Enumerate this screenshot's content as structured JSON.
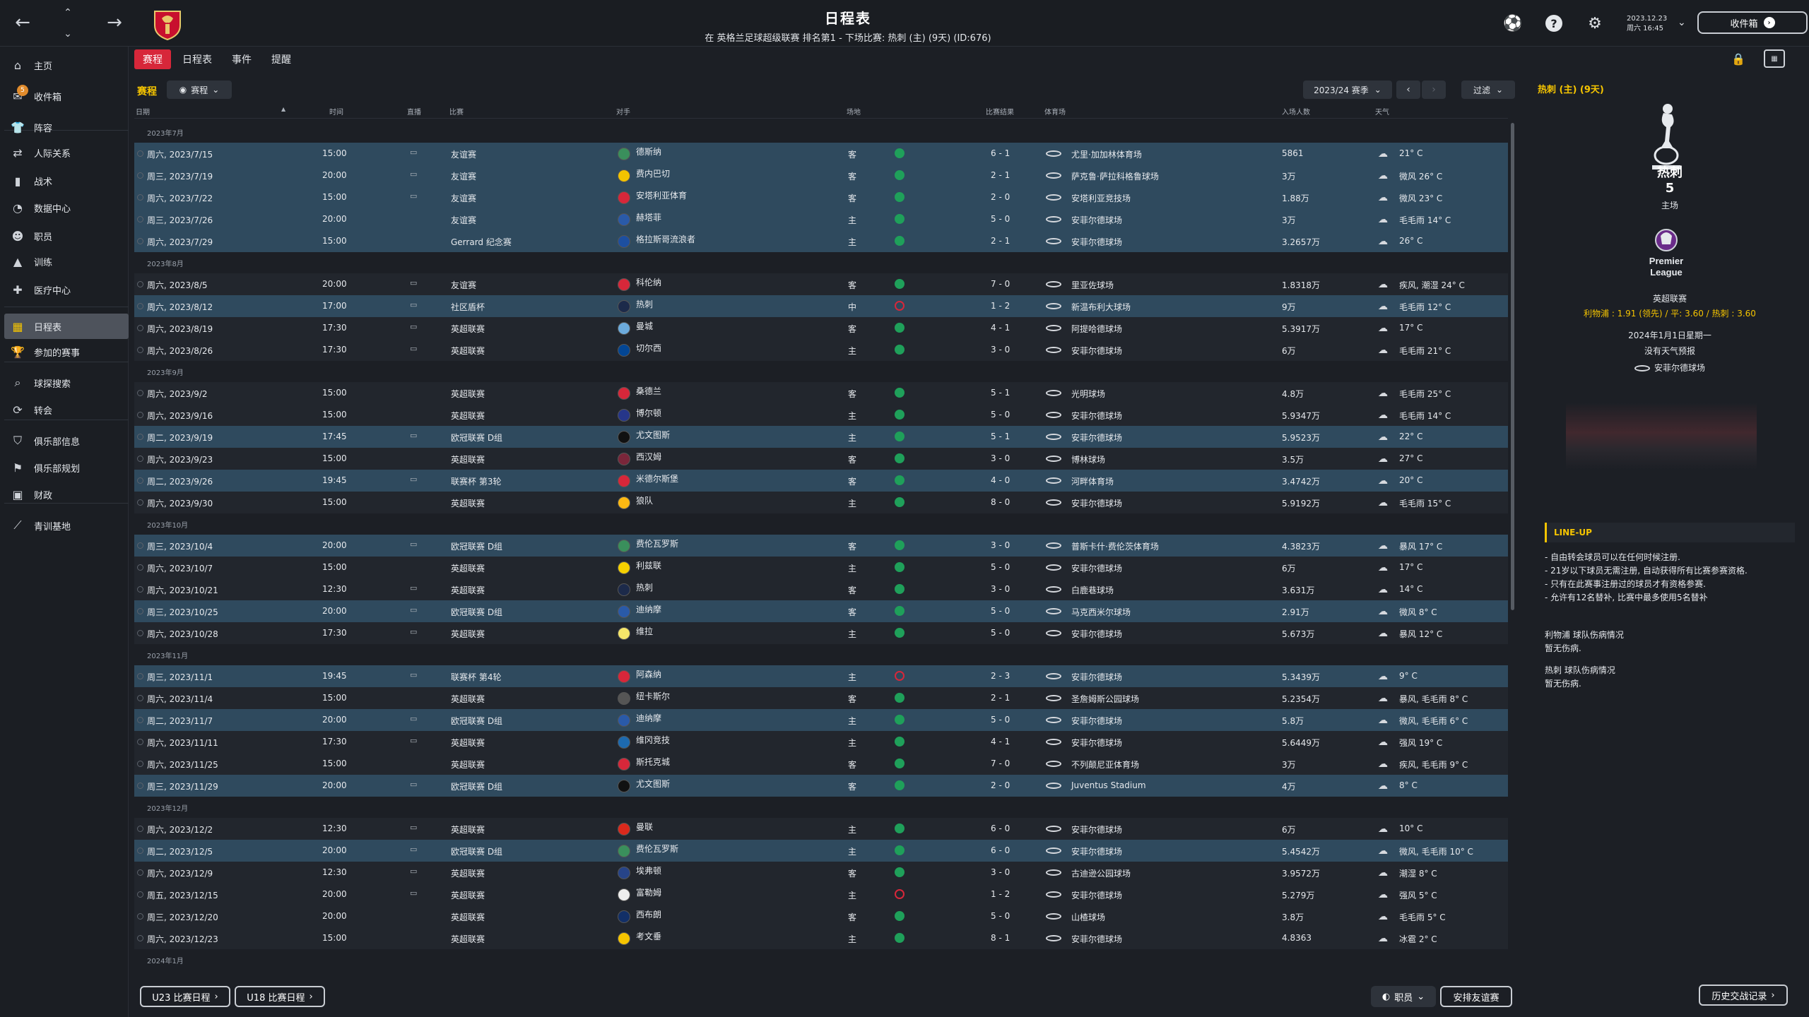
{
  "header": {
    "title": "日程表",
    "subtitle": "在 英格兰足球超级联赛 排名第1 - 下场比赛: 热刺 (主) (9天) (ID:676)",
    "date_line1": "2023.12.23",
    "date_line2": "周六 16:45",
    "inbox_label": "收件箱"
  },
  "sidebar": {
    "items": [
      {
        "label": "主页",
        "icon": "home-icon"
      },
      {
        "label": "收件箱",
        "icon": "inbox-icon",
        "badge": "5"
      },
      {
        "label": "阵容",
        "icon": "shirt-icon"
      },
      {
        "label": "人际关系",
        "icon": "relations-icon"
      },
      {
        "label": "战术",
        "icon": "tactics-icon"
      },
      {
        "label": "数据中心",
        "icon": "data-icon"
      },
      {
        "label": "职员",
        "icon": "staff-icon"
      },
      {
        "label": "训练",
        "icon": "training-icon"
      },
      {
        "label": "医疗中心",
        "icon": "medical-icon"
      },
      {
        "label": "日程表",
        "icon": "calendar-icon"
      },
      {
        "label": "参加的赛事",
        "icon": "trophy-icon"
      },
      {
        "label": "球探搜索",
        "icon": "search-icon"
      },
      {
        "label": "转会",
        "icon": "transfer-icon"
      },
      {
        "label": "俱乐部信息",
        "icon": "shield-icon"
      },
      {
        "label": "俱乐部规划",
        "icon": "vision-icon"
      },
      {
        "label": "财政",
        "icon": "finance-icon"
      },
      {
        "label": "青训基地",
        "icon": "youth-icon"
      }
    ]
  },
  "tabs": [
    "赛程",
    "日程表",
    "事件",
    "提醒"
  ],
  "subheader": {
    "title": "赛程",
    "dropdown": "赛程",
    "season": "2023/24 赛季",
    "filter": "过滤"
  },
  "columns": [
    "日期",
    "时间",
    "直播",
    "比赛",
    "对手",
    "场地",
    "比赛结果",
    "体育场",
    "入场人数",
    "天气"
  ],
  "groups": [
    {
      "month": "2023年7月",
      "rows": [
        {
          "date": "周六, 2023/7/15",
          "time": "15:00",
          "tv": true,
          "comp": "友谊赛",
          "opp": "德斯纳",
          "venue": "客",
          "res": "w",
          "score": "6 - 1",
          "stadium": "尤里·加加林体育场",
          "att": "5861",
          "weather": "21° C",
          "hl": true,
          "crest": "#3a8f5c"
        },
        {
          "date": "周三, 2023/7/19",
          "time": "20:00",
          "tv": true,
          "comp": "友谊赛",
          "opp": "费内巴切",
          "venue": "客",
          "res": "w",
          "score": "2 - 1",
          "stadium": "萨克鲁·萨拉科格鲁球场",
          "att": "3万",
          "weather": "微风 26° C",
          "hl": true,
          "crest": "#f2c300"
        },
        {
          "date": "周六, 2023/7/22",
          "time": "15:00",
          "tv": true,
          "comp": "友谊赛",
          "opp": "安塔利亚体育",
          "venue": "客",
          "res": "w",
          "score": "2 - 0",
          "stadium": "安塔利亚竞技场",
          "att": "1.88万",
          "weather": "微风 23° C",
          "hl": true,
          "crest": "#d7273a"
        },
        {
          "date": "周三, 2023/7/26",
          "time": "20:00",
          "tv": false,
          "comp": "友谊赛",
          "opp": "赫塔菲",
          "venue": "主",
          "res": "w",
          "score": "5 - 0",
          "stadium": "安菲尔德球场",
          "att": "3万",
          "weather": "毛毛雨 14° C",
          "hl": true,
          "crest": "#2a5aa8"
        },
        {
          "date": "周六, 2023/7/29",
          "time": "15:00",
          "tv": false,
          "comp": "Gerrard 纪念赛",
          "opp": "格拉斯哥流浪者",
          "venue": "主",
          "res": "w",
          "score": "2 - 1",
          "stadium": "安菲尔德球场",
          "att": "3.2657万",
          "weather": "26° C",
          "hl": true,
          "crest": "#1d4fa0"
        }
      ]
    },
    {
      "month": "2023年8月",
      "rows": [
        {
          "date": "周六, 2023/8/5",
          "time": "20:00",
          "tv": true,
          "comp": "友谊赛",
          "opp": "科伦纳",
          "venue": "客",
          "res": "w",
          "score": "7 - 0",
          "stadium": "里亚佐球场",
          "att": "1.8318万",
          "weather": "疾风, 潮湿 24° C",
          "hl": false,
          "crest": "#d7273a"
        },
        {
          "date": "周六, 2023/8/12",
          "time": "17:00",
          "tv": true,
          "comp": "社区盾杯",
          "opp": "热刺",
          "venue": "中",
          "res": "l",
          "score": "1 - 2",
          "stadium": "新温布利大球场",
          "att": "9万",
          "weather": "毛毛雨 12° C",
          "hl": true,
          "crest": "#1c2a4a"
        },
        {
          "date": "周六, 2023/8/19",
          "time": "17:30",
          "tv": true,
          "comp": "英超联赛",
          "opp": "曼城",
          "venue": "客",
          "res": "w",
          "score": "4 - 1",
          "stadium": "阿提哈德球场",
          "att": "5.3917万",
          "weather": "17° C",
          "hl": false,
          "crest": "#6cabdd"
        },
        {
          "date": "周六, 2023/8/26",
          "time": "17:30",
          "tv": true,
          "comp": "英超联赛",
          "opp": "切尔西",
          "venue": "主",
          "res": "w",
          "score": "3 - 0",
          "stadium": "安菲尔德球场",
          "att": "6万",
          "weather": "毛毛雨 21° C",
          "hl": false,
          "crest": "#034694"
        }
      ]
    },
    {
      "month": "2023年9月",
      "rows": [
        {
          "date": "周六, 2023/9/2",
          "time": "15:00",
          "tv": false,
          "comp": "英超联赛",
          "opp": "桑德兰",
          "venue": "客",
          "res": "w",
          "score": "5 - 1",
          "stadium": "光明球场",
          "att": "4.8万",
          "weather": "毛毛雨 25° C",
          "hl": false,
          "crest": "#d7273a"
        },
        {
          "date": "周六, 2023/9/16",
          "time": "15:00",
          "tv": false,
          "comp": "英超联赛",
          "opp": "博尔顿",
          "venue": "主",
          "res": "w",
          "score": "5 - 0",
          "stadium": "安菲尔德球场",
          "att": "5.9347万",
          "weather": "毛毛雨 14° C",
          "hl": false,
          "crest": "#26368a"
        },
        {
          "date": "周二, 2023/9/19",
          "time": "17:45",
          "tv": true,
          "comp": "欧冠联赛 D组",
          "opp": "尤文图斯",
          "venue": "主",
          "res": "w",
          "score": "5 - 1",
          "stadium": "安菲尔德球场",
          "att": "5.9523万",
          "weather": "22° C",
          "hl": true,
          "crest": "#111111"
        },
        {
          "date": "周六, 2023/9/23",
          "time": "15:00",
          "tv": false,
          "comp": "英超联赛",
          "opp": "西汉姆",
          "venue": "客",
          "res": "w",
          "score": "3 - 0",
          "stadium": "博林球场",
          "att": "3.5万",
          "weather": "27° C",
          "hl": false,
          "crest": "#7a263a"
        },
        {
          "date": "周二, 2023/9/26",
          "time": "19:45",
          "tv": true,
          "comp": "联赛杯 第3轮",
          "opp": "米德尔斯堡",
          "venue": "客",
          "res": "w",
          "score": "4 - 0",
          "stadium": "河畔体育场",
          "att": "3.4742万",
          "weather": "20° C",
          "hl": true,
          "crest": "#d7273a"
        },
        {
          "date": "周六, 2023/9/30",
          "time": "15:00",
          "tv": false,
          "comp": "英超联赛",
          "opp": "狼队",
          "venue": "主",
          "res": "w",
          "score": "8 - 0",
          "stadium": "安菲尔德球场",
          "att": "5.9192万",
          "weather": "毛毛雨 15° C",
          "hl": false,
          "crest": "#fdb913"
        }
      ]
    },
    {
      "month": "2023年10月",
      "rows": [
        {
          "date": "周三, 2023/10/4",
          "time": "20:00",
          "tv": true,
          "comp": "欧冠联赛 D组",
          "opp": "费伦瓦罗斯",
          "venue": "客",
          "res": "w",
          "score": "3 - 0",
          "stadium": "普斯卡什·费伦茨体育场",
          "att": "4.3823万",
          "weather": "暴风 17° C",
          "hl": true,
          "crest": "#3a8f5c"
        },
        {
          "date": "周六, 2023/10/7",
          "time": "15:00",
          "tv": false,
          "comp": "英超联赛",
          "opp": "利兹联",
          "venue": "主",
          "res": "w",
          "score": "5 - 0",
          "stadium": "安菲尔德球场",
          "att": "6万",
          "weather": "17° C",
          "hl": false,
          "crest": "#f5d000"
        },
        {
          "date": "周六, 2023/10/21",
          "time": "12:30",
          "tv": true,
          "comp": "英超联赛",
          "opp": "热刺",
          "venue": "客",
          "res": "w",
          "score": "3 - 0",
          "stadium": "白鹿巷球场",
          "att": "3.631万",
          "weather": "14° C",
          "hl": false,
          "crest": "#1c2a4a"
        },
        {
          "date": "周三, 2023/10/25",
          "time": "20:00",
          "tv": true,
          "comp": "欧冠联赛 D组",
          "opp": "迪纳摩",
          "venue": "客",
          "res": "w",
          "score": "5 - 0",
          "stadium": "马克西米尔球场",
          "att": "2.91万",
          "weather": "微风 8° C",
          "hl": true,
          "crest": "#2a5aa8"
        },
        {
          "date": "周六, 2023/10/28",
          "time": "17:30",
          "tv": true,
          "comp": "英超联赛",
          "opp": "维拉",
          "venue": "主",
          "res": "w",
          "score": "5 - 0",
          "stadium": "安菲尔德球场",
          "att": "5.673万",
          "weather": "暴风 12° C",
          "hl": false,
          "crest": "#f5e66a"
        }
      ]
    },
    {
      "month": "2023年11月",
      "rows": [
        {
          "date": "周三, 2023/11/1",
          "time": "19:45",
          "tv": true,
          "comp": "联赛杯 第4轮",
          "opp": "阿森纳",
          "venue": "主",
          "res": "l",
          "score": "2 - 3",
          "stadium": "安菲尔德球场",
          "att": "5.3439万",
          "weather": "9° C",
          "hl": true,
          "crest": "#d7273a"
        },
        {
          "date": "周六, 2023/11/4",
          "time": "15:00",
          "tv": false,
          "comp": "英超联赛",
          "opp": "纽卡斯尔",
          "venue": "客",
          "res": "w",
          "score": "2 - 1",
          "stadium": "圣詹姆斯公园球场",
          "att": "5.2354万",
          "weather": "暴风, 毛毛雨 8° C",
          "hl": false,
          "crest": "#555555"
        },
        {
          "date": "周二, 2023/11/7",
          "time": "20:00",
          "tv": true,
          "comp": "欧冠联赛 D组",
          "opp": "迪纳摩",
          "venue": "主",
          "res": "w",
          "score": "5 - 0",
          "stadium": "安菲尔德球场",
          "att": "5.8万",
          "weather": "微风, 毛毛雨 6° C",
          "hl": true,
          "crest": "#2a5aa8"
        },
        {
          "date": "周六, 2023/11/11",
          "time": "17:30",
          "tv": true,
          "comp": "英超联赛",
          "opp": "维冈竞技",
          "venue": "主",
          "res": "w",
          "score": "4 - 1",
          "stadium": "安菲尔德球场",
          "att": "5.6449万",
          "weather": "强风 19° C",
          "hl": false,
          "crest": "#1d6ab0"
        },
        {
          "date": "周六, 2023/11/25",
          "time": "15:00",
          "tv": false,
          "comp": "英超联赛",
          "opp": "斯托克城",
          "venue": "客",
          "res": "w",
          "score": "7 - 0",
          "stadium": "不列颠尼亚体育场",
          "att": "3万",
          "weather": "疾风, 毛毛雨 9° C",
          "hl": false,
          "crest": "#d7273a"
        },
        {
          "date": "周三, 2023/11/29",
          "time": "20:00",
          "tv": true,
          "comp": "欧冠联赛 D组",
          "opp": "尤文图斯",
          "venue": "客",
          "res": "w",
          "score": "2 - 0",
          "stadium": "Juventus Stadium",
          "att": "4万",
          "weather": "8° C",
          "hl": true,
          "crest": "#111111"
        }
      ]
    },
    {
      "month": "2023年12月",
      "rows": [
        {
          "date": "周六, 2023/12/2",
          "time": "12:30",
          "tv": true,
          "comp": "英超联赛",
          "opp": "曼联",
          "venue": "主",
          "res": "w",
          "score": "6 - 0",
          "stadium": "安菲尔德球场",
          "att": "6万",
          "weather": "10° C",
          "hl": false,
          "crest": "#da291c"
        },
        {
          "date": "周二, 2023/12/5",
          "time": "20:00",
          "tv": true,
          "comp": "欧冠联赛 D组",
          "opp": "费伦瓦罗斯",
          "venue": "主",
          "res": "w",
          "score": "6 - 0",
          "stadium": "安菲尔德球场",
          "att": "5.4542万",
          "weather": "微风, 毛毛雨 10° C",
          "hl": true,
          "crest": "#3a8f5c"
        },
        {
          "date": "周六, 2023/12/9",
          "time": "12:30",
          "tv": true,
          "comp": "英超联赛",
          "opp": "埃弗顿",
          "venue": "客",
          "res": "w",
          "score": "3 - 0",
          "stadium": "古迪逊公园球场",
          "att": "3.9572万",
          "weather": "潮湿 8° C",
          "hl": false,
          "crest": "#274488"
        },
        {
          "date": "周五, 2023/12/15",
          "time": "20:00",
          "tv": true,
          "comp": "英超联赛",
          "opp": "富勒姆",
          "venue": "主",
          "res": "l",
          "score": "1 - 2",
          "stadium": "安菲尔德球场",
          "att": "5.279万",
          "weather": "强风 5° C",
          "hl": false,
          "crest": "#eeeeee"
        },
        {
          "date": "周三, 2023/12/20",
          "time": "20:00",
          "tv": false,
          "comp": "英超联赛",
          "opp": "西布朗",
          "venue": "客",
          "res": "w",
          "score": "5 - 0",
          "stadium": "山楂球场",
          "att": "3.8万",
          "weather": "毛毛雨 5° C",
          "hl": false,
          "crest": "#122f67"
        },
        {
          "date": "周六, 2023/12/23",
          "time": "15:00",
          "tv": false,
          "comp": "英超联赛",
          "opp": "考文垂",
          "venue": "主",
          "res": "w",
          "score": "8 - 1",
          "stadium": "安菲尔德球场",
          "att": "4.8363",
          "weather": "冰雹 2° C",
          "hl": false,
          "crest": "#f5c400"
        }
      ]
    },
    {
      "month": "2024年1月",
      "rows": []
    }
  ],
  "right_panel": {
    "title": "热刺 (主) (9天)",
    "team": "热刺",
    "position": "5",
    "home_label": "主场",
    "league": "英超联赛",
    "odds": "利物浦 : 1.91 (领先) / 平: 3.60 / 热刺 : 3.60",
    "match_date": "2024年1月1日星期一",
    "weather": "没有天气预报",
    "stadium": "安菲尔德球场",
    "pl_logo_text": "Premier League",
    "lineup_title": "LINE-UP",
    "lineup_notes": [
      "- 自由转会球员可以在任何时候注册.",
      "- 21岁以下球员无需注册, 自动获得所有比赛参赛资格.",
      "- 只有在此赛事注册过的球员才有资格参赛.",
      "- 允许有12名替补, 比赛中最多使用5名替补"
    ],
    "injury1_title": "利物浦 球队伤病情况",
    "injury1_text": "暂无伤病.",
    "injury2_title": "热刺 球队伤病情况",
    "injury2_text": "暂无伤病."
  },
  "footer": {
    "u23": "U23 比赛日程",
    "u18": "U18 比赛日程",
    "staff": "职员",
    "arrange": "安排友谊赛",
    "history": "历史交战记录"
  },
  "colors": {
    "accent_red": "#d7273a",
    "accent_yellow": "#f5c400",
    "win_green": "#1fa05a",
    "highlight_row": "#2f4a5e"
  }
}
